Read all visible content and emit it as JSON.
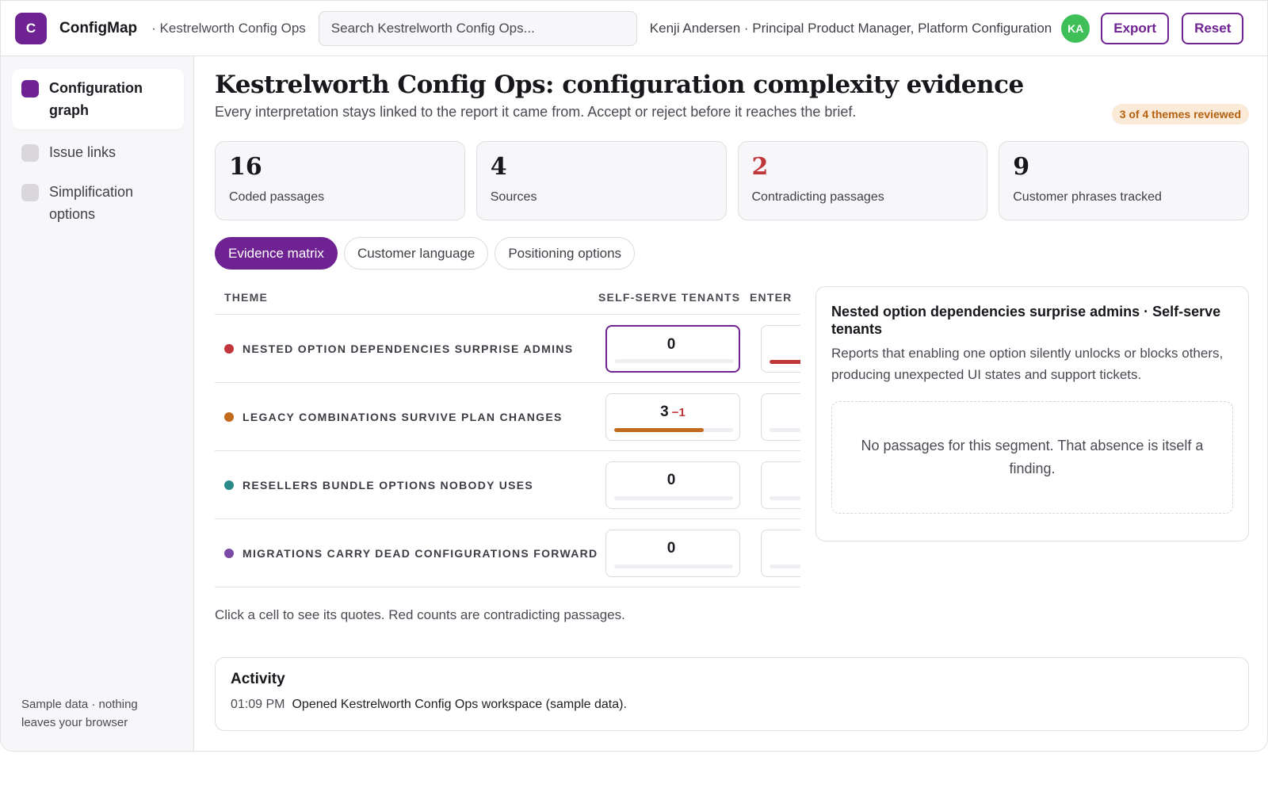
{
  "app": {
    "logo_letter": "C",
    "name": "ConfigMap",
    "workspace": "· Kestrelworth Config Ops"
  },
  "search": {
    "placeholder": "Search Kestrelworth Config Ops..."
  },
  "user": {
    "label": "Kenji Andersen · Principal Product Manager, Platform Configuration",
    "initials": "KA"
  },
  "toolbar": {
    "export_label": "Export",
    "reset_label": "Reset"
  },
  "sidebar": {
    "items": [
      {
        "label": "Configuration graph",
        "active": true
      },
      {
        "label": "Issue links",
        "active": false
      },
      {
        "label": "Simplification options",
        "active": false
      }
    ],
    "footer": "Sample data · nothing leaves your browser"
  },
  "page": {
    "title": "Kestrelworth Config Ops: configuration complexity evidence",
    "subtitle": "Every interpretation stays linked to the report it came from. Accept or reject before it reaches the brief.",
    "review_badge": "3 of 4 themes reviewed"
  },
  "stats": [
    {
      "value": "16",
      "label": "Coded passages"
    },
    {
      "value": "4",
      "label": "Sources"
    },
    {
      "value": "2",
      "label": "Contradicting passages"
    },
    {
      "value": "9",
      "label": "Customer phrases tracked"
    }
  ],
  "tabs": [
    {
      "label": "Evidence matrix",
      "active": true
    },
    {
      "label": "Customer language",
      "active": false
    },
    {
      "label": "Positioning options",
      "active": false
    }
  ],
  "matrix": {
    "columns": [
      "THEME",
      "SELF-SERVE TENANTS",
      "ENTER"
    ],
    "rows": [
      {
        "theme": "NESTED OPTION DEPENDENCIES SURPRISE ADMINS",
        "color": "#c0373b",
        "count": "0",
        "contra": "",
        "fill": 0,
        "next_fill": 0.35
      },
      {
        "theme": "LEGACY COMBINATIONS SURVIVE PLAN CHANGES",
        "color": "#c26a1e",
        "count": "3",
        "contra": "−1",
        "fill": 0.75,
        "next_fill": 0
      },
      {
        "theme": "RESELLERS BUNDLE OPTIONS NOBODY USES",
        "color": "#2b8a8a",
        "count": "0",
        "contra": "",
        "fill": 0,
        "next_fill": 0
      },
      {
        "theme": "MIGRATIONS CARRY DEAD CONFIGURATIONS FORWARD",
        "color": "#7a4aa6",
        "count": "0",
        "contra": "",
        "fill": 0,
        "next_fill": 0
      }
    ],
    "note": "Click a cell to see its quotes. Red counts are contradicting passages."
  },
  "detail": {
    "title": "Nested option dependencies surprise admins · Self-serve tenants",
    "description": "Reports that enabling one option silently unlocks or blocks others, producing unexpected UI states and support tickets.",
    "empty": "No passages for this segment. That absence is itself a finding."
  },
  "activity": {
    "title": "Activity",
    "entries": [
      {
        "time": "01:09 PM",
        "text": "Opened Kestrelworth Config Ops workspace (sample data)."
      }
    ]
  },
  "colors": {
    "accent": "#6f2292",
    "contradiction": "#c0373b",
    "avatar": "#3fbf57"
  }
}
